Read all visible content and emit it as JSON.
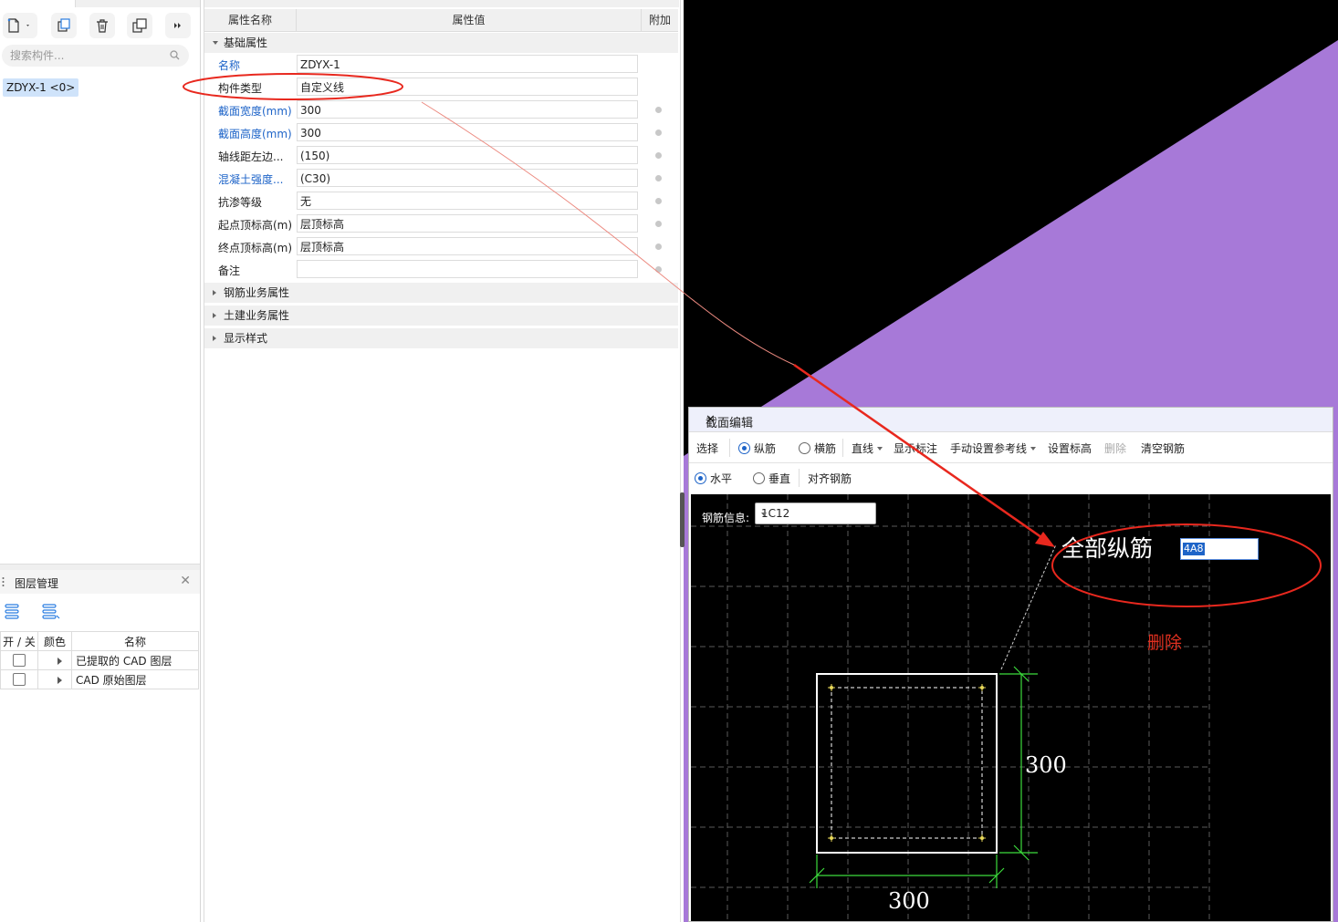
{
  "left_panel": {
    "search_placeholder": "搜索构件...",
    "component_item": "ZDYX-1 <0>",
    "layer_panel": {
      "title": "图层管理",
      "columns": [
        "开 / 关",
        "颜色",
        "名称"
      ],
      "rows": [
        {
          "name": "已提取的 CAD 图层"
        },
        {
          "name": "CAD 原始图层"
        }
      ]
    }
  },
  "property_panel": {
    "headers": {
      "name": "属性名称",
      "value": "属性值",
      "extra": "附加"
    },
    "groups": {
      "basic": "基础属性",
      "rebar_business": "钢筋业务属性",
      "civil_business": "土建业务属性",
      "display_style": "显示样式"
    },
    "rows": [
      {
        "name": "名称",
        "value": "ZDYX-1"
      },
      {
        "name": "构件类型",
        "value": "自定义线"
      },
      {
        "name": "截面宽度(mm)",
        "value": "300"
      },
      {
        "name": "截面高度(mm)",
        "value": "300"
      },
      {
        "name": "轴线距左边...",
        "value": "(150)"
      },
      {
        "name": "混凝土强度...",
        "value": "(C30)"
      },
      {
        "name": "抗渗等级",
        "value": "无"
      },
      {
        "name": "起点顶标高(m)",
        "value": "层顶标高"
      },
      {
        "name": "终点顶标高(m)",
        "value": "层顶标高"
      },
      {
        "name": "备注",
        "value": ""
      }
    ]
  },
  "section_dialog": {
    "title": "截面编辑",
    "toolbar1": {
      "select": "选择",
      "longitudinal": "纵筋",
      "stirrup": "横筋",
      "line": "直线",
      "show_annotation": "显示标注",
      "manual_ref_line": "手动设置参考线",
      "set_elevation": "设置标高",
      "delete": "删除",
      "clear_rebar": "清空钢筋"
    },
    "toolbar2": {
      "horizontal": "水平",
      "vertical": "垂直",
      "align_rebar": "对齐钢筋"
    },
    "rebar_info_label": "钢筋信息:",
    "rebar_info_value": "1C12",
    "all_rebar_label": "全部纵筋",
    "all_rebar_value": "4A8",
    "annotation_delete": "删除",
    "dim_height": "300",
    "dim_width": "300"
  },
  "colors": {
    "annotation_red": "#e8281e",
    "purple_region": "#a779d8",
    "dimension_green": "#3ddc3d",
    "link_blue": "#1e64c8"
  }
}
